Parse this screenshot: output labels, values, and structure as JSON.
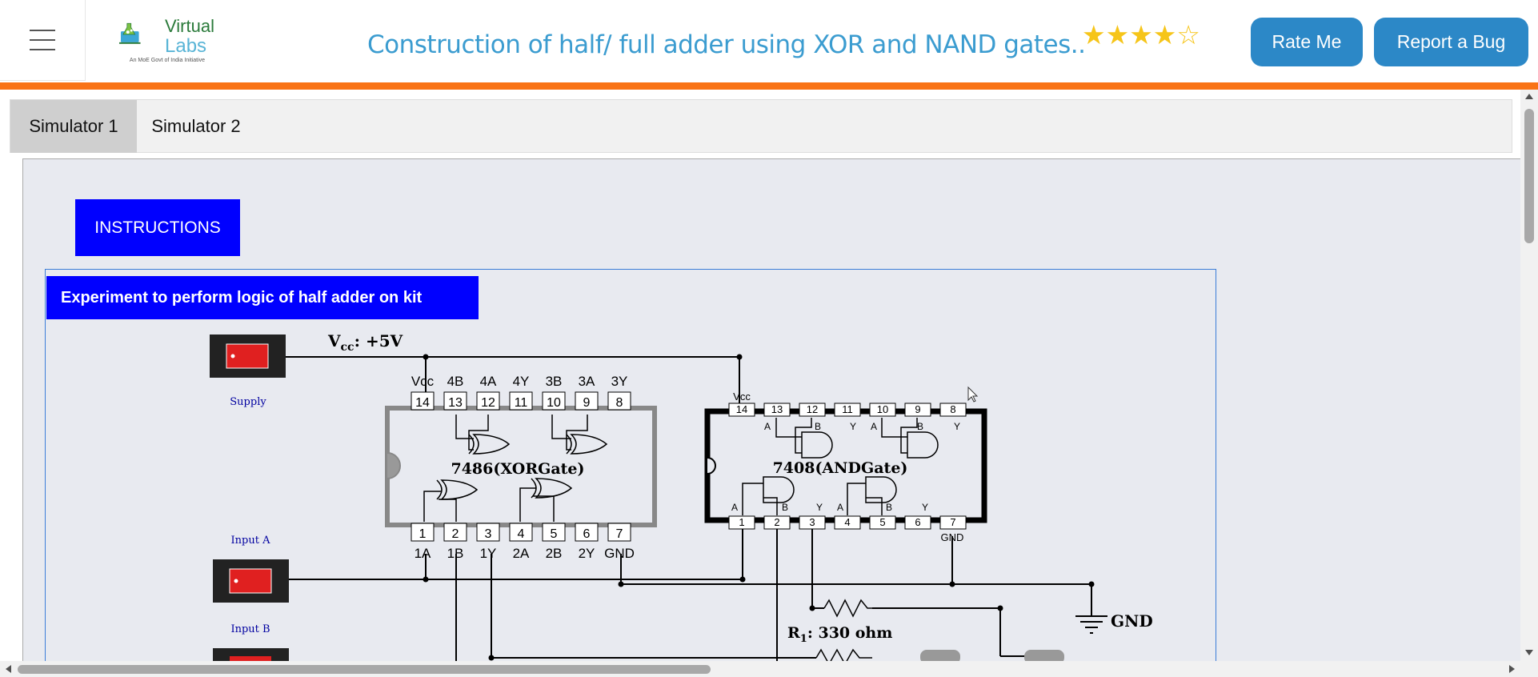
{
  "header": {
    "logo_virtual": "Virtual",
    "logo_labs": "Labs",
    "logo_sub": "An MoE Govt of India Initiative",
    "title": "Construction of half/ full adder using XOR and NAND gates..",
    "rating": {
      "filled": 4,
      "total": 5
    },
    "rate_button": "Rate Me",
    "bug_button": "Report a Bug"
  },
  "tabs": [
    {
      "label": "Simulator 1",
      "active": true
    },
    {
      "label": "Simulator 2",
      "active": false
    }
  ],
  "simulator": {
    "instructions_label": "INSTRUCTIONS",
    "experiment_title": "Experiment to perform logic of half adder on kit",
    "supply_label": "Supply",
    "input_a_label": "Input A",
    "input_b_label": "Input B",
    "vcc_label": "V",
    "vcc_sub": "cc",
    "vcc_value": ": +5V",
    "xor_ic": {
      "name": "7486(XORGate)",
      "top_pin_labels": [
        "Vcc",
        "4B",
        "4A",
        "4Y",
        "3B",
        "3A",
        "3Y"
      ],
      "top_pins": [
        "14",
        "13",
        "12",
        "11",
        "10",
        "9",
        "8"
      ],
      "bottom_pins": [
        "1",
        "2",
        "3",
        "4",
        "5",
        "6",
        "7"
      ],
      "bottom_pin_labels": [
        "1A",
        "1B",
        "1Y",
        "2A",
        "2B",
        "2Y",
        "GND"
      ]
    },
    "and_ic": {
      "name": "7408(ANDGate)",
      "vcc_label": "Vcc",
      "gnd_label": "GND",
      "top_pins": [
        "14",
        "13",
        "12",
        "11",
        "10",
        "9",
        "8"
      ],
      "bottom_pins": [
        "1",
        "2",
        "3",
        "4",
        "5",
        "6",
        "7"
      ],
      "gate_labels": [
        "A",
        "B",
        "Y"
      ]
    },
    "resistor_label": "R",
    "resistor_sub": "1",
    "resistor_value": ": 330 ohm",
    "gnd_label": "GND"
  },
  "colors": {
    "accent_blue": "#3b9cd0",
    "button_blue": "#2c88c7",
    "orange_bar": "#f97316",
    "instruction_blue": "#0000ff",
    "switch_red": "#e02020"
  }
}
